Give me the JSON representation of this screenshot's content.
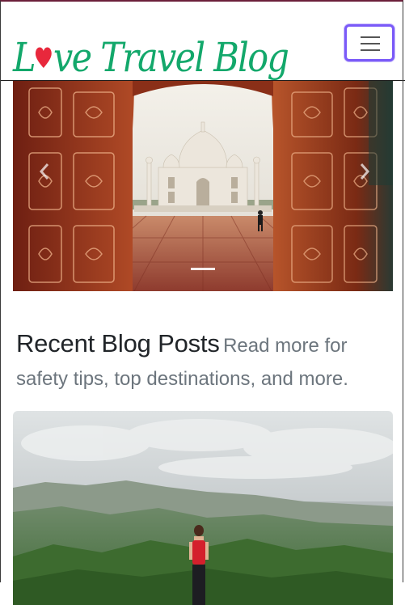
{
  "navbar": {
    "brand_text": "Love Travel Blog",
    "brand_color": "#13a86b",
    "heart_color": "#e8283c",
    "toggler_icon": "hamburger-menu-icon"
  },
  "carousel": {
    "image_subject": "Taj Mahal viewed through ornate red arched doorway",
    "prev_icon": "chevron-left-icon",
    "next_icon": "chevron-right-icon",
    "slide_count": 1,
    "active_slide": 1
  },
  "recent": {
    "title": "Recent Blog Posts",
    "subtitle": "Read more for safety tips, top destinations, and more."
  },
  "card": {
    "image_subject": "Traveler standing on green mountain ridge overlooking valley"
  },
  "colors": {
    "text_dark": "#212529",
    "text_muted": "#6c757d",
    "toggler_focus": "#7a5af8"
  }
}
